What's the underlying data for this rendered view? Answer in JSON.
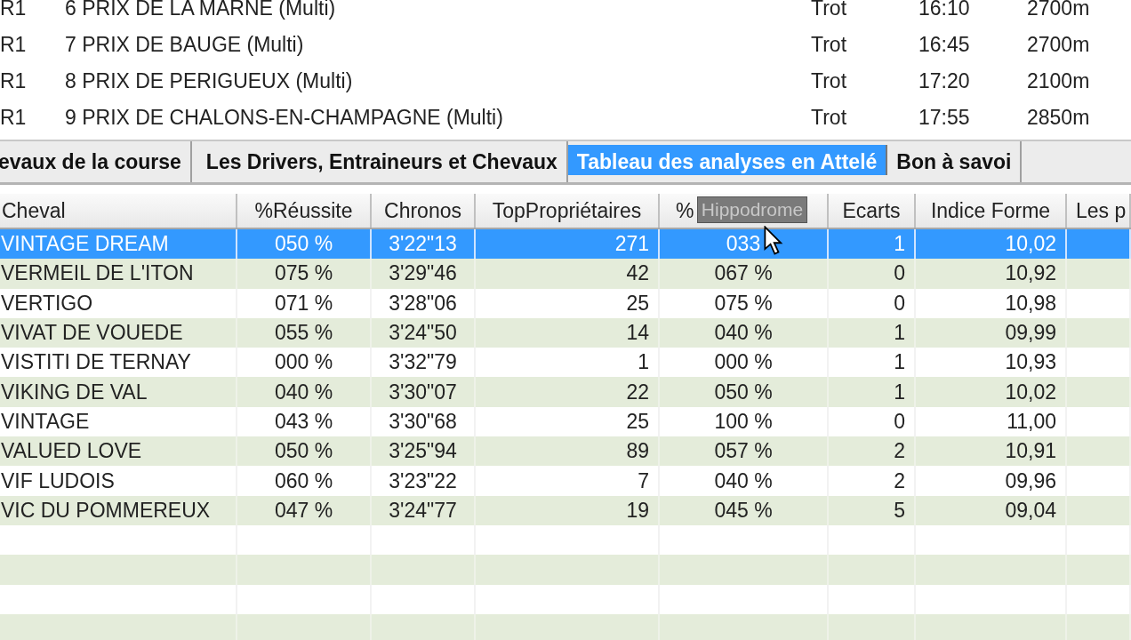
{
  "races": [
    {
      "meeting": "R1",
      "name": "6 PRIX DE LA MARNE (Multi)",
      "discipline": "Trot",
      "time": "16:10",
      "distance": "2700m"
    },
    {
      "meeting": "R1",
      "name": "7 PRIX DE BAUGE (Multi)",
      "discipline": "Trot",
      "time": "16:45",
      "distance": "2700m"
    },
    {
      "meeting": "R1",
      "name": "8 PRIX DE PERIGUEUX (Multi)",
      "discipline": "Trot",
      "time": "17:20",
      "distance": "2100m"
    },
    {
      "meeting": "R1",
      "name": "9 PRIX DE CHALONS-EN-CHAMPAGNE (Multi)",
      "discipline": "Trot",
      "time": "17:55",
      "distance": "2850m"
    }
  ],
  "tabs": [
    {
      "label": "evaux de la course",
      "selected": false
    },
    {
      "label": "Les Drivers, Entraineurs et Chevaux",
      "selected": false
    },
    {
      "label": "Tableau des analyses en Attelé",
      "selected": true
    },
    {
      "label": "Bon à savoi",
      "selected": false
    }
  ],
  "table": {
    "columns": [
      "Cheval",
      "%Réussite",
      "Chronos",
      "TopPropriétaires",
      "%",
      "Ecarts",
      "Indice Forme",
      "Les p"
    ],
    "tooltip": "Hippodrome",
    "rows": [
      {
        "cells": [
          "VINTAGE DREAM",
          "050 %",
          "3'22\"13",
          "271",
          "033",
          "1",
          "10,02"
        ],
        "selected": true
      },
      {
        "cells": [
          "VERMEIL DE L'ITON",
          "075 %",
          "3'29\"46",
          "42",
          "067 %",
          "0",
          "10,92"
        ],
        "selected": false
      },
      {
        "cells": [
          "VERTIGO",
          "071 %",
          "3'28\"06",
          "25",
          "075 %",
          "0",
          "10,98"
        ],
        "selected": false
      },
      {
        "cells": [
          "VIVAT DE VOUEDE",
          "055 %",
          "3'24\"50",
          "14",
          "040 %",
          "1",
          "09,99"
        ],
        "selected": false
      },
      {
        "cells": [
          "VISTITI DE TERNAY",
          "000 %",
          "3'32\"79",
          "1",
          "000 %",
          "1",
          "10,93"
        ],
        "selected": false
      },
      {
        "cells": [
          "VIKING DE VAL",
          "040 %",
          "3'30\"07",
          "22",
          "050 %",
          "1",
          "10,02"
        ],
        "selected": false
      },
      {
        "cells": [
          "VINTAGE",
          "043 %",
          "3'30\"68",
          "25",
          "100 %",
          "0",
          "11,00"
        ],
        "selected": false
      },
      {
        "cells": [
          "VALUED LOVE",
          "050 %",
          "3'25\"94",
          "89",
          "057 %",
          "2",
          "10,91"
        ],
        "selected": false
      },
      {
        "cells": [
          "VIF LUDOIS",
          "060 %",
          "3'23\"22",
          "7",
          "040 %",
          "2",
          "09,96"
        ],
        "selected": false
      },
      {
        "cells": [
          "VIC DU POMMEREUX",
          "047 %",
          "3'24\"77",
          "19",
          "045 %",
          "5",
          "09,04"
        ],
        "selected": false
      }
    ]
  }
}
